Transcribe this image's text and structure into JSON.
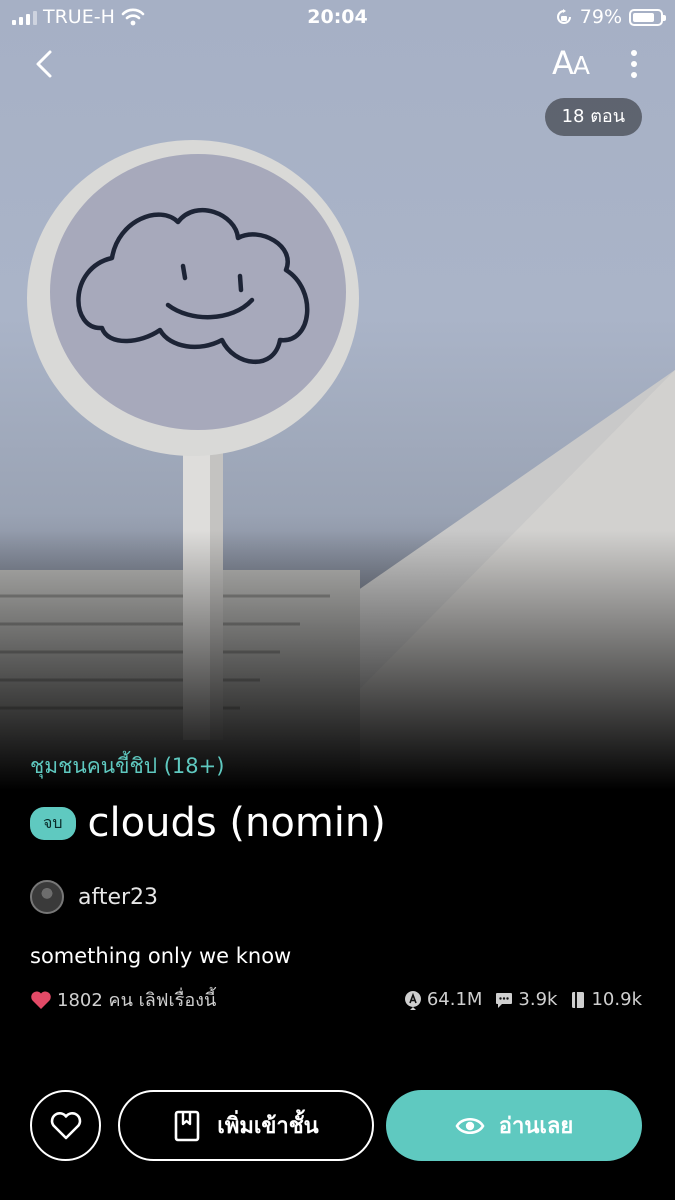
{
  "status_bar": {
    "carrier": "TRUE-H",
    "time": "20:04",
    "battery": "79%"
  },
  "nav": {
    "font_size_label_big": "A",
    "font_size_label_small": "A"
  },
  "episodes_badge": "18 ตอน",
  "story": {
    "category": "ชุมชนคนขี้ชิป (18+)",
    "status": "จบ",
    "title": "clouds (nomin)",
    "author": "after23",
    "description": "something only we know",
    "likes": "1802 คน เลิฟเรื่องนี้",
    "views": "64.1M",
    "comments": "3.9k",
    "shelf_adds": "10.9k"
  },
  "actions": {
    "add_shelf": "เพิ่มเข้าชั้น",
    "read_now": "อ่านเลย"
  },
  "colors": {
    "accent": "#5fc9c0",
    "heart": "#e34a67"
  }
}
